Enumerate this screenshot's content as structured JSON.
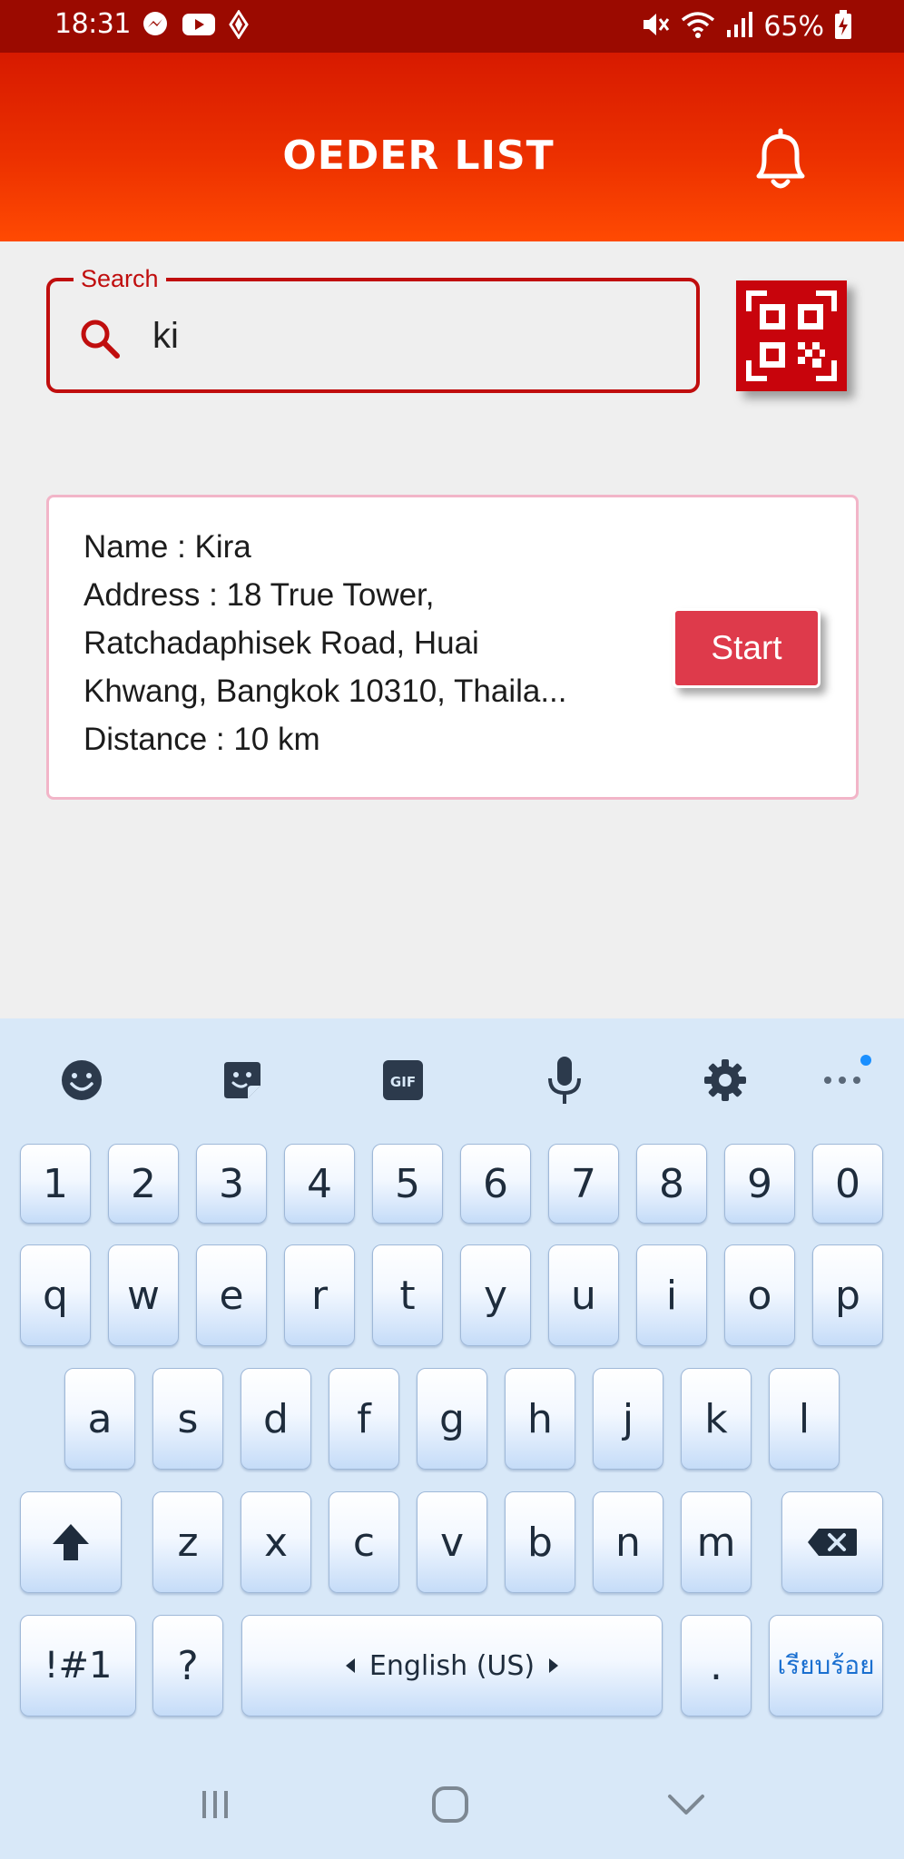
{
  "status_bar": {
    "time": "18:31",
    "battery": "65%",
    "icons": [
      "messenger-icon",
      "youtube-icon",
      "diamond-icon",
      "mute-icon",
      "wifi-icon",
      "signal-icon",
      "battery-charging-icon"
    ]
  },
  "app_bar": {
    "title": "OEDER LIST",
    "bell_icon": "bell-icon"
  },
  "search": {
    "label": "Search",
    "value": "ki",
    "icon": "search-icon",
    "qr_icon": "qr-code-icon"
  },
  "orders": [
    {
      "name_line": "Name : Kira",
      "address_line1": "Address : 18 True Tower,",
      "address_line2": "Ratchadaphisek Road, Huai",
      "address_line3": "Khwang, Bangkok 10310, Thaila...",
      "distance_line": "Distance : 10 km",
      "button_label": "Start"
    }
  ],
  "keyboard": {
    "toolbar": [
      "emoji-icon",
      "sticker-icon",
      "gif-icon",
      "mic-icon",
      "settings-icon",
      "more-icon"
    ],
    "gif_label": "GIF",
    "row_numbers": [
      "1",
      "2",
      "3",
      "4",
      "5",
      "6",
      "7",
      "8",
      "9",
      "0"
    ],
    "row_top": [
      "q",
      "w",
      "e",
      "r",
      "t",
      "y",
      "u",
      "i",
      "o",
      "p"
    ],
    "row_middle": [
      "a",
      "s",
      "d",
      "f",
      "g",
      "h",
      "j",
      "k",
      "l"
    ],
    "row_bottom": [
      "z",
      "x",
      "c",
      "v",
      "b",
      "n",
      "m"
    ],
    "symbols_label": "!#1",
    "question_label": "?",
    "space_label": "English (US)",
    "period_label": ".",
    "done_label": "เรียบร้อย"
  },
  "colors": {
    "status_bar": "#9b0a00",
    "app_bar_top": "#d71a00",
    "app_bar_bottom": "#ff4a02",
    "accent_red": "#c00e0e",
    "start_button": "#de3a4b",
    "card_border": "#f2b5c8",
    "keyboard_bg": "#d8e8f8"
  }
}
